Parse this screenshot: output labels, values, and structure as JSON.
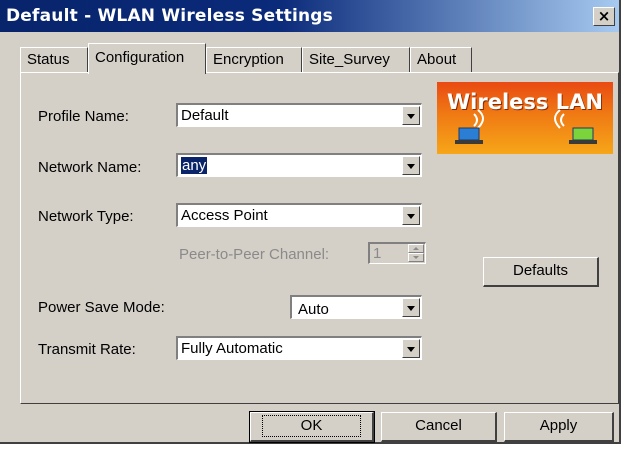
{
  "window": {
    "title": "Default - WLAN Wireless Settings",
    "close_glyph": "×"
  },
  "tabs": [
    {
      "label": "Status"
    },
    {
      "label": "Configuration"
    },
    {
      "label": "Encryption"
    },
    {
      "label": "Site_Survey"
    },
    {
      "label": "About"
    }
  ],
  "active_tab": "Configuration",
  "form": {
    "profile_name": {
      "label": "Profile Name:",
      "value": "Default"
    },
    "network_name": {
      "label": "Network Name:",
      "value": "any"
    },
    "network_type": {
      "label": "Network Type:",
      "value": "Access Point"
    },
    "peer_channel": {
      "label": "Peer-to-Peer Channel:",
      "value": "1"
    },
    "power_save": {
      "label": "Power Save Mode:",
      "value": "Auto"
    },
    "transmit_rate": {
      "label": "Transmit Rate:",
      "value": "Fully Automatic"
    }
  },
  "logo": {
    "text": "Wireless LAN"
  },
  "buttons": {
    "defaults": "Defaults",
    "ok": "OK",
    "cancel": "Cancel",
    "apply": "Apply"
  },
  "colors": {
    "title_bar": "#08246b",
    "face": "#d4d0c8",
    "logo_orange": "#f07a14",
    "selection": "#0a246a"
  }
}
